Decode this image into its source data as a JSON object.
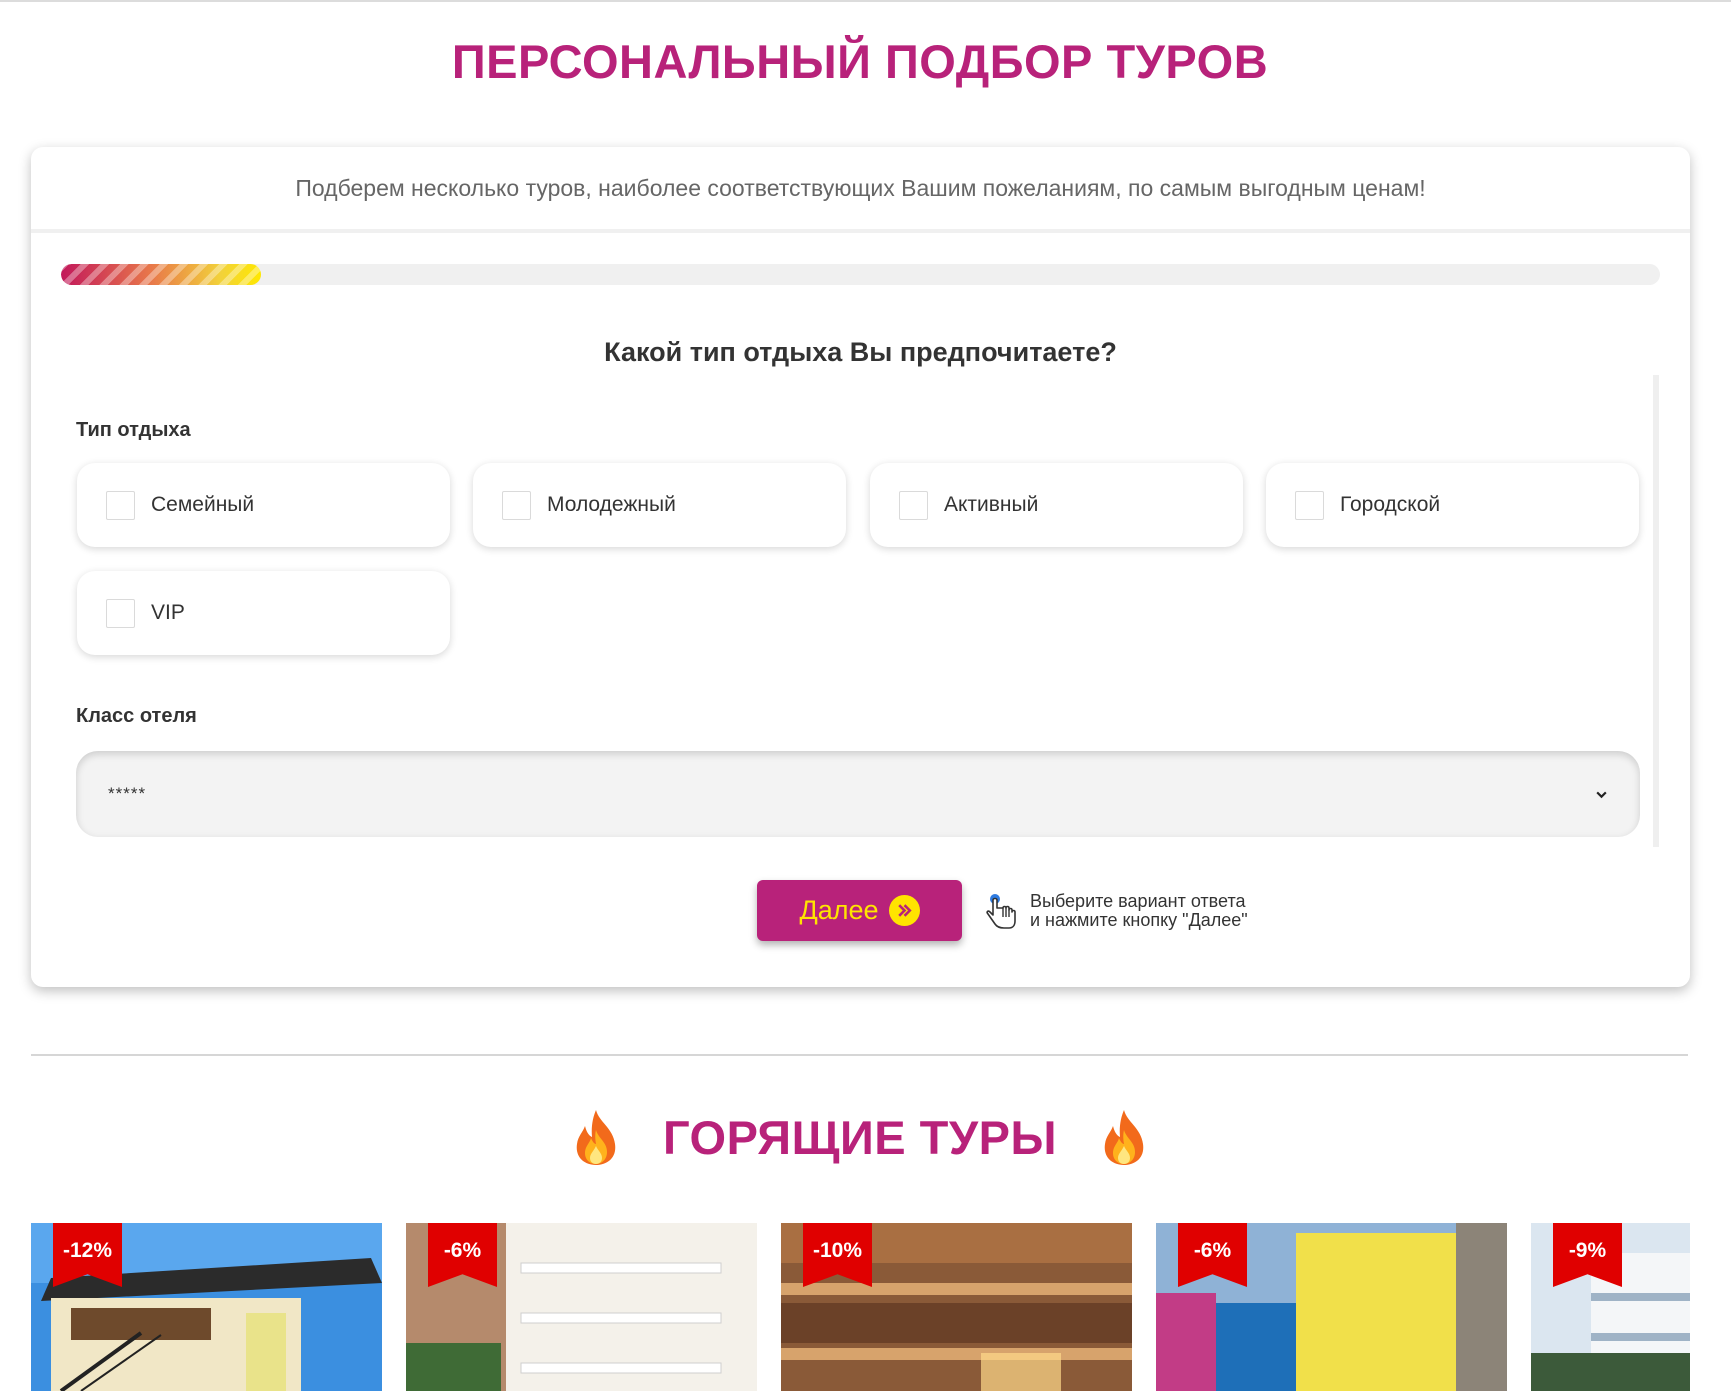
{
  "page": {
    "title": "ПЕРСОНАЛЬНЫЙ ПОДБОР ТУРОВ"
  },
  "quiz": {
    "subtitle": "Подберем несколько туров, наиболее соответствующих Вашим пожеланиям, по самым выгодным ценам!",
    "progress": 0.125,
    "question": "Какой тип отдыха Вы предпочитаете?",
    "rest_type": {
      "label": "Тип отдыха",
      "options": [
        {
          "label": "Семейный",
          "checked": false
        },
        {
          "label": "Молодежный",
          "checked": false
        },
        {
          "label": "Активный",
          "checked": false
        },
        {
          "label": "Городской",
          "checked": false
        },
        {
          "label": "VIP",
          "checked": false
        }
      ]
    },
    "hotel_class": {
      "label": "Класс отеля",
      "selected": "*****"
    },
    "next_button": {
      "label": "Далее",
      "icon": "double-chevron-right-icon"
    },
    "hint": {
      "icon": "pointing-hand-icon",
      "line1": "Выберите вариант ответа",
      "line2": "и нажмите кнопку \"Далее\""
    }
  },
  "hot_tours": {
    "title": "ГОРЯЩИЕ ТУРЫ",
    "icon": "fire-icon",
    "cards": [
      {
        "discount": "-12%"
      },
      {
        "discount": "-6%"
      },
      {
        "discount": "-10%"
      },
      {
        "discount": "-6%"
      },
      {
        "discount": "-9%"
      }
    ]
  },
  "colors": {
    "brand": "#b8227a",
    "accent_yellow": "#ffe400",
    "badge_red": "#e00000"
  }
}
